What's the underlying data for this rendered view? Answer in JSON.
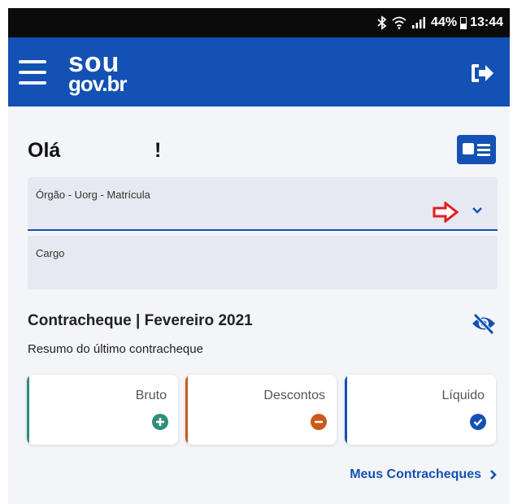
{
  "status_bar": {
    "bluetooth_icon": "bluetooth-icon",
    "wifi_icon": "wifi-icon",
    "signal_icon": "signal-icon",
    "battery_text": "44%",
    "battery_level": 0.44,
    "time": "13:44"
  },
  "header": {
    "logo_sou": "sou",
    "logo_gov": "gov.br",
    "menu_icon": "hamburger-menu-icon",
    "logout_icon": "logout-icon",
    "color": "#1351b4"
  },
  "greeting": {
    "text": "Olá",
    "exclamation": "!"
  },
  "fields": {
    "orgao_label": "Órgão - Uorg - Matrícula",
    "cargo_label": "Cargo"
  },
  "contracheque": {
    "title": "Contracheque | Fevereiro 2021",
    "subtitle": "Resumo do último contracheque",
    "cards": [
      {
        "label": "Bruto",
        "icon": "plus-circle-icon",
        "color": "#2e8f7e"
      },
      {
        "label": "Descontos",
        "icon": "minus-circle-icon",
        "color": "#c85a1c"
      },
      {
        "label": "Líquido",
        "icon": "check-circle-icon",
        "color": "#1351b4"
      }
    ]
  },
  "footer_link": {
    "label": "Meus Contracheques"
  }
}
